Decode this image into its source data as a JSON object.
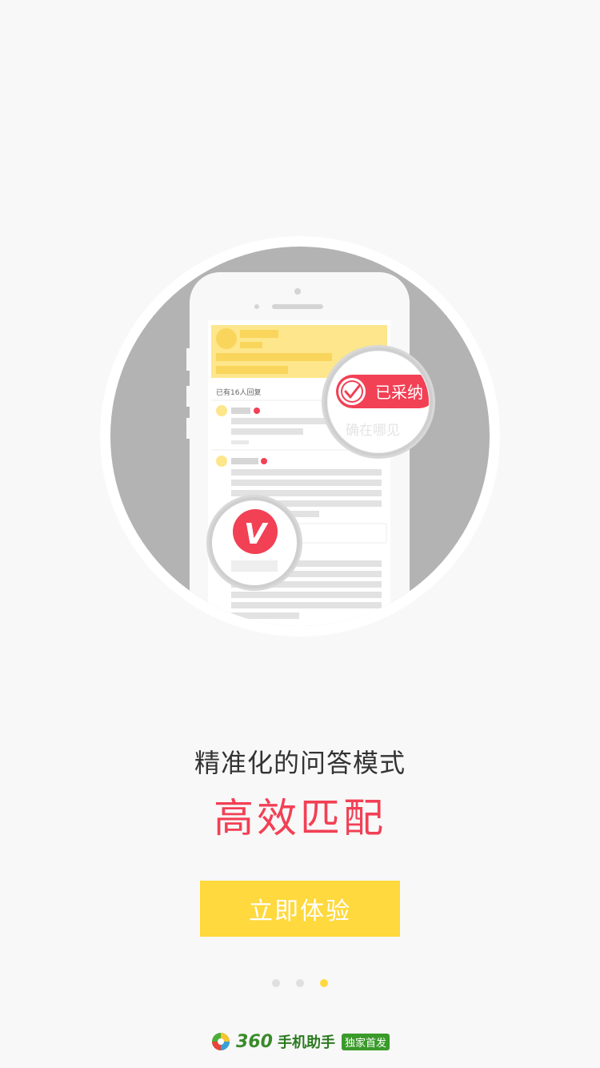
{
  "illustration": {
    "reply_count": "已有16人回复",
    "adopted_badge": "已采纳",
    "magnifier_sub_text": "确在哪见",
    "verified_letter": "V"
  },
  "intro": {
    "subtitle": "精准化的问答模式",
    "headline": "高效匹配"
  },
  "cta": {
    "label": "立即体验"
  },
  "pager": {
    "count": 3,
    "active_index": 2
  },
  "footer": {
    "brand_number": "360",
    "brand_name": "手机助手",
    "badge": "独家首发",
    "logo_icon": "360-logo-icon"
  },
  "colors": {
    "accent_red": "#f24055",
    "accent_yellow": "#ffd93d",
    "brand_green": "#3a9a2a"
  }
}
